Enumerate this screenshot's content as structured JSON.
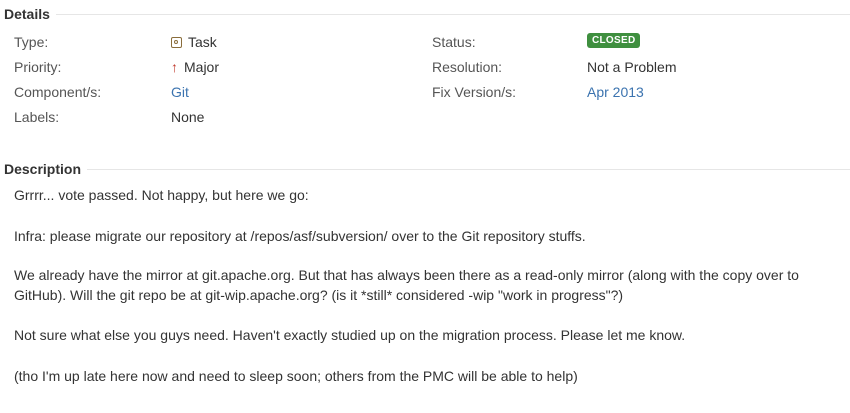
{
  "details": {
    "title": "Details",
    "type_label": "Type:",
    "type_value": "Task",
    "type_icon": "task-icon",
    "priority_label": "Priority:",
    "priority_value": "Major",
    "priority_icon": "arrow-up-icon",
    "priority_color": "#c0392b",
    "components_label": "Component/s:",
    "components_value": "Git",
    "labels_label": "Labels:",
    "labels_value": "None",
    "status_label": "Status:",
    "status_value": "CLOSED",
    "status_color": "#3f8f3f",
    "resolution_label": "Resolution:",
    "resolution_value": "Not a Problem",
    "fix_version_label": "Fix Version/s:",
    "fix_version_value": "Apr 2013",
    "link_color": "#3b73af"
  },
  "description": {
    "title": "Description",
    "paragraphs": [
      "Grrrr... vote passed. Not happy, but here we go:",
      "Infra: please migrate our repository at /repos/asf/subversion/ over to the Git repository stuffs.",
      "We already have the mirror at git.apache.org. But that has always been there as a read-only mirror (along with the copy over to GitHub). Will the git repo be at git-wip.apache.org? (is it *still* considered -wip \"work in progress\"?)",
      "Not sure what else you guys need. Haven't exactly studied up on the migration process. Please let me know.",
      "(tho I'm up late here now and need to sleep soon; others from the PMC will be able to help)"
    ]
  }
}
